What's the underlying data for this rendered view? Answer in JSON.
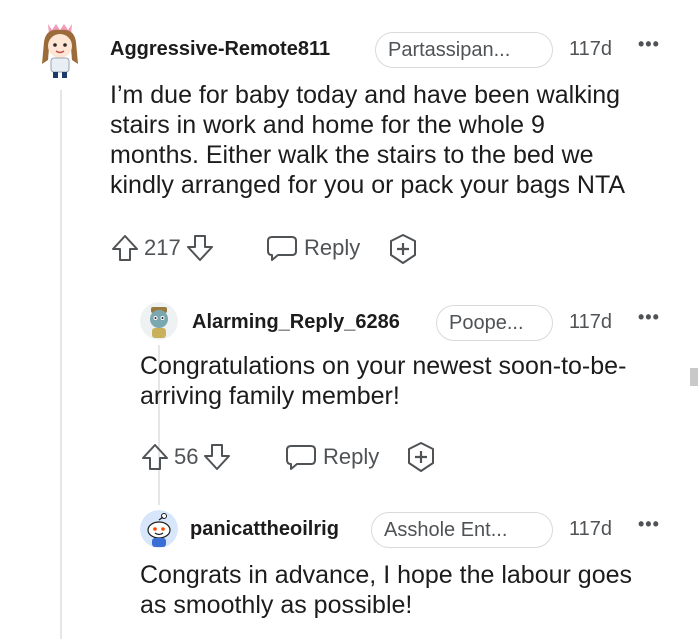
{
  "comments": [
    {
      "username": "Aggressive-Remote811",
      "flair": "Partassipan...",
      "age": "117d",
      "more": "•••",
      "body_lines": [
        "I’m due for baby today and have been walking",
        "stairs in work and home for the whole 9",
        "months. Either walk the stairs to the bed we",
        "kindly arranged for you or pack your bags NTA"
      ],
      "votes": "217",
      "reply_label": "Reply"
    },
    {
      "username": "Alarming_Reply_6286",
      "flair": "Poope...",
      "age": "117d",
      "more": "•••",
      "body_lines": [
        "Congratulations on your newest soon-to-be-",
        "arriving family member!"
      ],
      "votes": "56",
      "reply_label": "Reply"
    },
    {
      "username": "panicattheoilrig",
      "flair": "Asshole Ent...",
      "age": "117d",
      "more": "•••",
      "body_lines": [
        "Congrats in advance, I hope the labour goes",
        "as smoothly as possible!"
      ]
    }
  ],
  "icons": {
    "upvote": "arrow-up-icon",
    "downvote": "arrow-down-icon",
    "reply": "speech-bubble-icon",
    "award": "award-plus-icon",
    "more": "more-options-icon"
  },
  "colors": {
    "text": "#1c1c1c",
    "meta": "#505356",
    "border": "#d8dadc",
    "thread_line": "#e4e6e8"
  }
}
